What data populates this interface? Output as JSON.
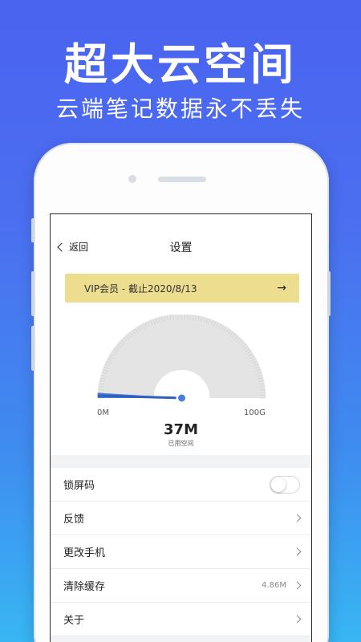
{
  "headline": "超大云空间",
  "subline": "云端笔记数据永不丢失",
  "nav": {
    "back_label": "返回",
    "title": "设置"
  },
  "vip_banner": {
    "text": "VIP会员 - 截止2020/8/13",
    "arrow": "→"
  },
  "storage": {
    "min_label": "0M",
    "max_label": "100G",
    "used_value": "37M",
    "used_caption": "已用空间",
    "used_fraction": 0.02
  },
  "settings": [
    {
      "label": "锁屏码",
      "type": "toggle",
      "on": false
    },
    {
      "label": "反馈",
      "type": "link"
    },
    {
      "label": "更改手机",
      "type": "link"
    },
    {
      "label": "清除缓存",
      "type": "link",
      "value": "4.86M"
    },
    {
      "label": "关于",
      "type": "link"
    }
  ],
  "colors": {
    "bg_top": "#4a63f0",
    "bg_bottom": "#38b6f3",
    "vip_bg": "#ecdd8f",
    "accent": "#4a7fd8"
  }
}
